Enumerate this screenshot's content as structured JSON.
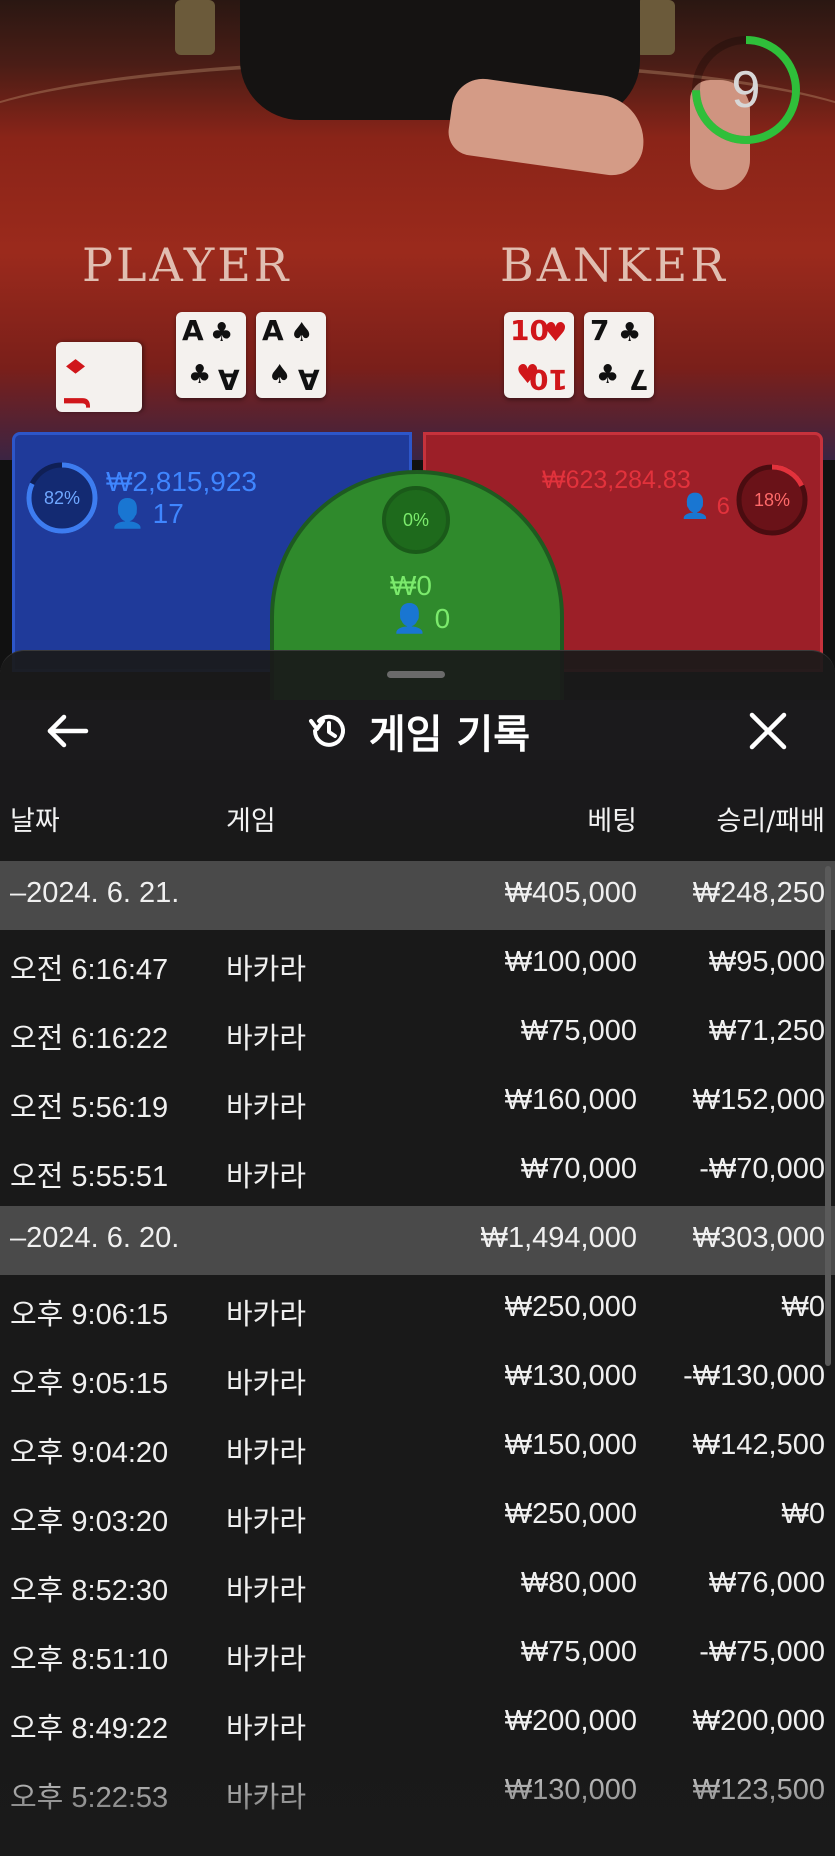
{
  "table": {
    "timer_value": "9",
    "player_label": "PLAYER",
    "banker_label": "BANKER",
    "player_cards": [
      {
        "rank": "J",
        "suit": "♦",
        "red": true
      },
      {
        "rank": "A",
        "suit": "♣",
        "red": false
      },
      {
        "rank": "A",
        "suit": "♠",
        "red": false
      }
    ],
    "banker_cards": [
      {
        "rank": "10",
        "suit": "♥",
        "red": true
      },
      {
        "rank": "7",
        "suit": "♣",
        "red": false
      }
    ],
    "player_bet": {
      "percent": "82%",
      "amount": "₩2,815,923",
      "players": "17"
    },
    "banker_bet": {
      "percent": "18%",
      "amount": "₩623,284.83",
      "players": "6"
    },
    "tie_bet": {
      "percent": "0%",
      "amount": "₩0",
      "players": "0"
    },
    "colors": {
      "player": "#1f3a9a",
      "banker": "#9c1f28",
      "tie": "#2f8a2c",
      "timer": "#2fbf3a"
    }
  },
  "sheet": {
    "title": "게임 기록",
    "title_icon": "history-icon",
    "back_icon": "arrow-left-icon",
    "close_icon": "close-icon",
    "columns": {
      "date": "날짜",
      "game": "게임",
      "bet": "베팅",
      "result": "승리/패배"
    },
    "groups": [
      {
        "date": "–2024. 6. 21.",
        "bet_total": "₩405,000",
        "result_total": "₩248,250",
        "rows": [
          {
            "time": "오전 6:16:47",
            "game": "바카라",
            "bet": "₩100,000",
            "result": "₩95,000"
          },
          {
            "time": "오전 6:16:22",
            "game": "바카라",
            "bet": "₩75,000",
            "result": "₩71,250"
          },
          {
            "time": "오전 5:56:19",
            "game": "바카라",
            "bet": "₩160,000",
            "result": "₩152,000"
          },
          {
            "time": "오전 5:55:51",
            "game": "바카라",
            "bet": "₩70,000",
            "result": "-₩70,000"
          }
        ]
      },
      {
        "date": "–2024. 6. 20.",
        "bet_total": "₩1,494,000",
        "result_total": "₩303,000",
        "rows": [
          {
            "time": "오후 9:06:15",
            "game": "바카라",
            "bet": "₩250,000",
            "result": "₩0"
          },
          {
            "time": "오후 9:05:15",
            "game": "바카라",
            "bet": "₩130,000",
            "result": "-₩130,000"
          },
          {
            "time": "오후 9:04:20",
            "game": "바카라",
            "bet": "₩150,000",
            "result": "₩142,500"
          },
          {
            "time": "오후 9:03:20",
            "game": "바카라",
            "bet": "₩250,000",
            "result": "₩0"
          },
          {
            "time": "오후 8:52:30",
            "game": "바카라",
            "bet": "₩80,000",
            "result": "₩76,000"
          },
          {
            "time": "오후 8:51:10",
            "game": "바카라",
            "bet": "₩75,000",
            "result": "-₩75,000"
          },
          {
            "time": "오후 8:49:22",
            "game": "바카라",
            "bet": "₩200,000",
            "result": "₩200,000"
          },
          {
            "time": "오후 5:22:53",
            "game": "바카라",
            "bet": "₩130,000",
            "result": "₩123,500"
          }
        ]
      }
    ]
  }
}
